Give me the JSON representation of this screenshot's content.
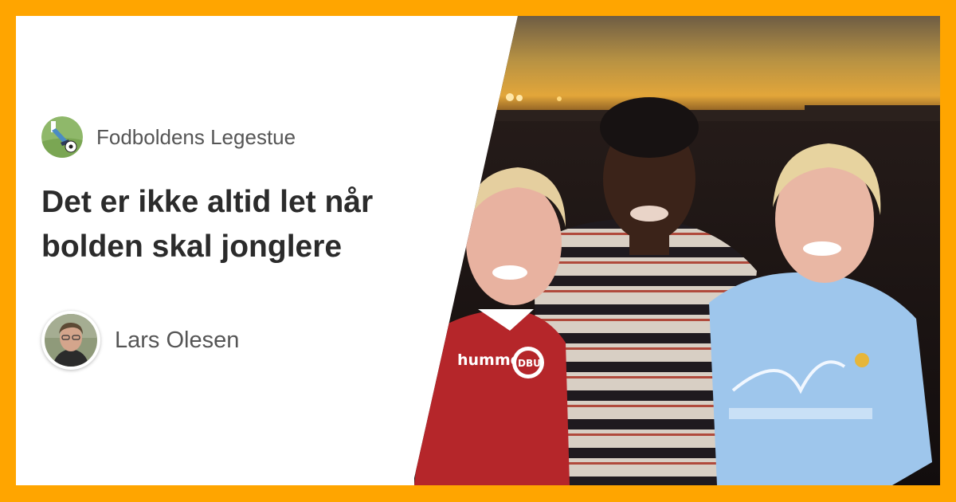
{
  "publication": {
    "name": "Fodboldens Legestue",
    "logo_icon": "soccer-kick-icon"
  },
  "article": {
    "title": "Det er ikke altid let når bolden skal jonglere"
  },
  "author": {
    "name": "Lars Olesen",
    "avatar_icon": "author-portrait"
  },
  "photo": {
    "jersey_left_brand": "hummel",
    "jersey_left_badge": "DBU"
  },
  "colors": {
    "border": "#ffa500",
    "card": "#ffffff",
    "title": "#2b2b2b",
    "meta": "#555555"
  }
}
